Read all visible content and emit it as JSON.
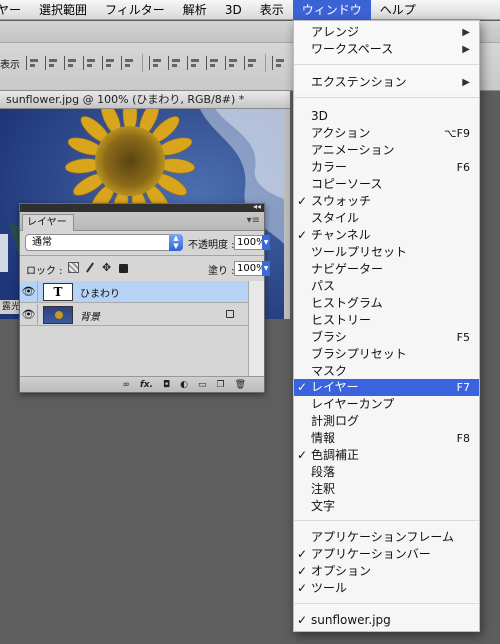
{
  "menubar": {
    "items": [
      "ヤー",
      "選択範囲",
      "フィルター",
      "解析",
      "3D",
      "表示",
      "ウィンドウ",
      "ヘルプ"
    ],
    "active_index": 6
  },
  "optionsbar": {
    "show_label": "表示"
  },
  "document": {
    "title": "sunflower.jpg @ 100% (ひまわり, RGB/8#) *",
    "status": "露光"
  },
  "layers_panel": {
    "tab": "レイヤー",
    "blend_mode": "通常",
    "opacity_label": "不透明度 :",
    "opacity_value": "100%",
    "lock_label": "ロック :",
    "fill_label": "塗り :",
    "fill_value": "100%",
    "layers": [
      {
        "thumb": "T",
        "name": "ひまわり",
        "selected": true
      },
      {
        "thumb": "",
        "name": "背景",
        "selected": false,
        "locked": true
      }
    ],
    "bottom_icons": [
      "link-icon",
      "fx",
      "mask-icon",
      "adjustment-icon",
      "folder-icon",
      "new-layer-icon",
      "trash-icon"
    ],
    "fx_label": "fx."
  },
  "window_menu": {
    "items": [
      {
        "label": "アレンジ",
        "submenu": true
      },
      {
        "label": "ワークスペース",
        "submenu": true
      },
      {
        "label": "エクステンション",
        "submenu": true
      },
      {
        "label": "3D"
      },
      {
        "label": "アクション",
        "shortcut": "⌥F9"
      },
      {
        "label": "アニメーション"
      },
      {
        "label": "カラー",
        "shortcut": "F6"
      },
      {
        "label": "コピーソース"
      },
      {
        "label": "スウォッチ",
        "checked": true
      },
      {
        "label": "スタイル"
      },
      {
        "label": "チャンネル",
        "checked": true
      },
      {
        "label": "ツールプリセット"
      },
      {
        "label": "ナビゲーター"
      },
      {
        "label": "パス"
      },
      {
        "label": "ヒストグラム"
      },
      {
        "label": "ヒストリー"
      },
      {
        "label": "ブラシ",
        "shortcut": "F5"
      },
      {
        "label": "ブラシプリセット"
      },
      {
        "label": "マスク"
      },
      {
        "label": "レイヤー",
        "shortcut": "F7",
        "checked": true,
        "highlighted": true
      },
      {
        "label": "レイヤーカンプ"
      },
      {
        "label": "計測ログ"
      },
      {
        "label": "情報",
        "shortcut": "F8"
      },
      {
        "label": "色調補正",
        "checked": true
      },
      {
        "label": "段落"
      },
      {
        "label": "注釈"
      },
      {
        "label": "文字"
      },
      {
        "label": "アプリケーションフレーム"
      },
      {
        "label": "アプリケーションバー",
        "checked": true
      },
      {
        "label": "オプション",
        "checked": true
      },
      {
        "label": "ツール",
        "checked": true
      },
      {
        "label": "sunflower.jpg",
        "checked": true
      }
    ],
    "check_glyph": "✓",
    "submenu_glyph": "▶"
  },
  "colors": {
    "menu_highlight": "#3b63de",
    "menubar_active": "#3c63d6",
    "layer_selected": "#b6d2f5",
    "workspace_bg": "#5e5e5e"
  }
}
